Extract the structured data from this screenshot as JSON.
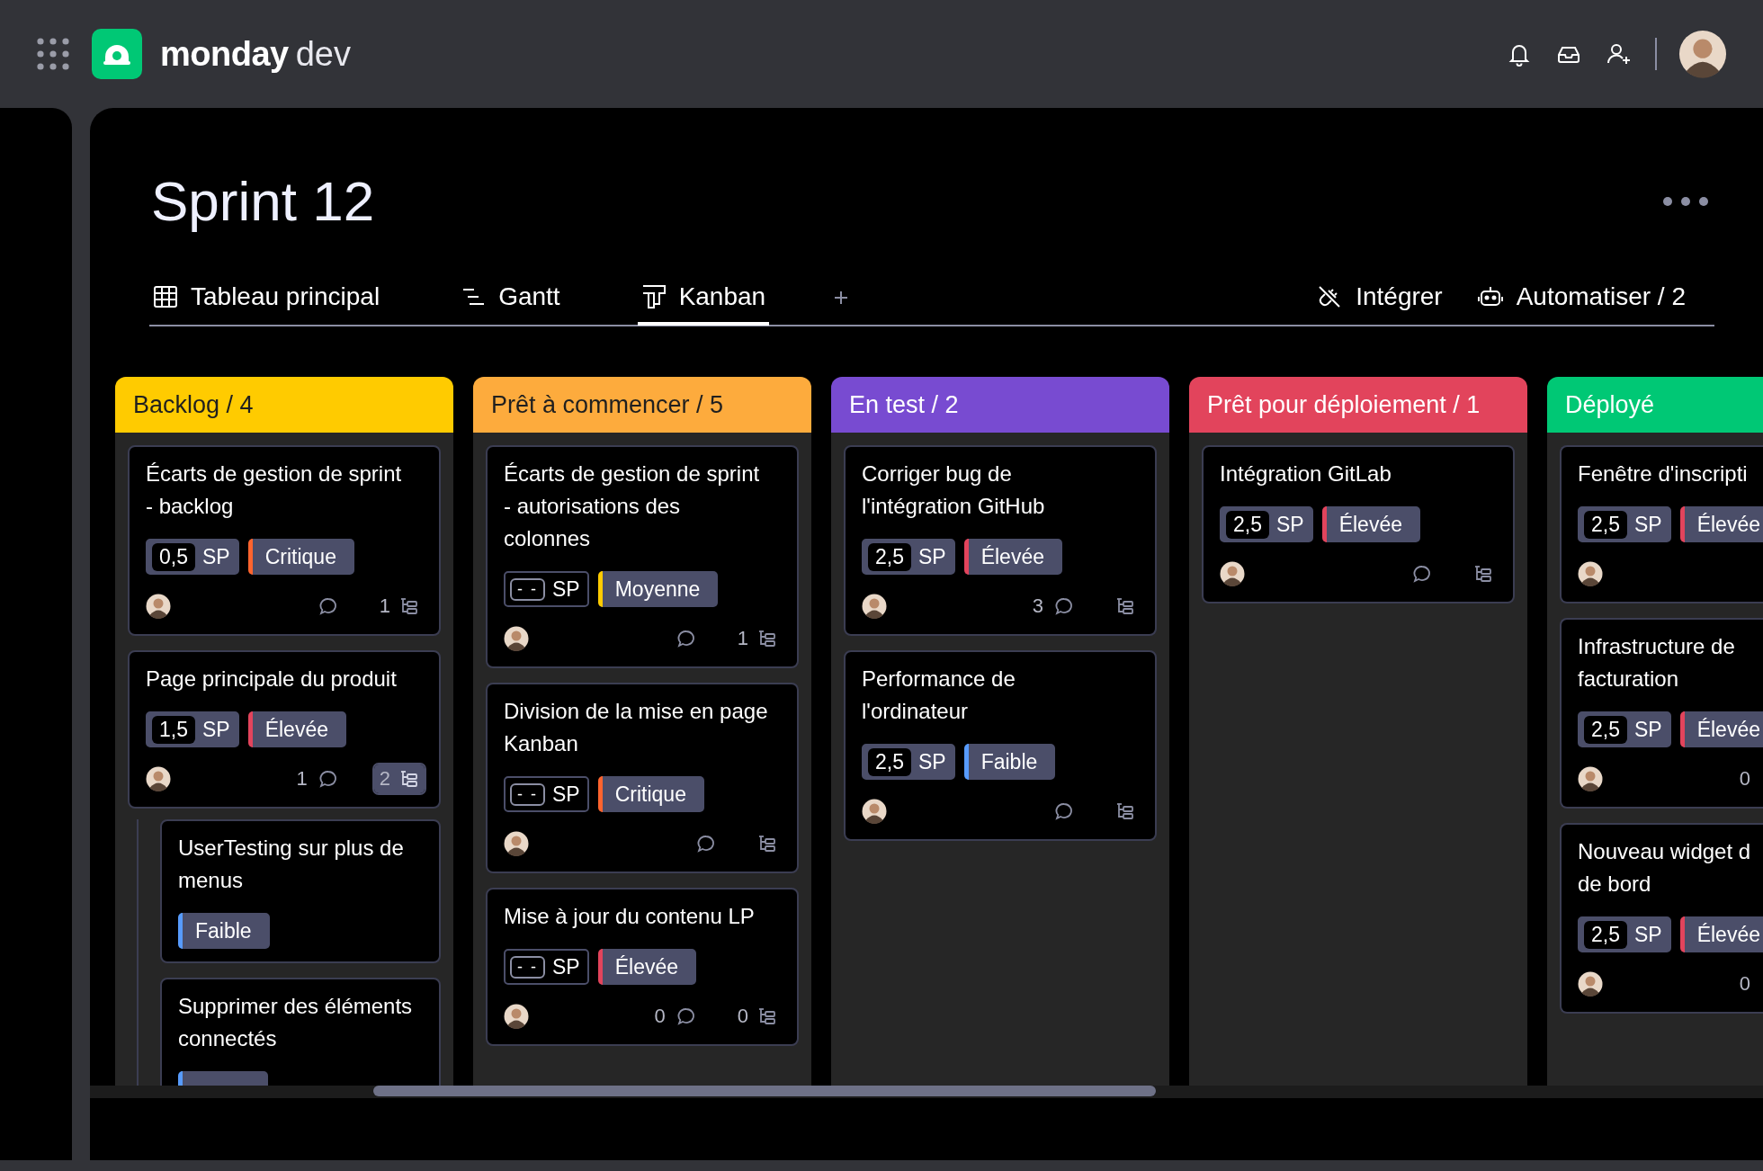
{
  "app": {
    "brand": "monday",
    "product": "dev"
  },
  "board": {
    "title": "Sprint 12"
  },
  "views": [
    {
      "label": "Tableau principal",
      "kind": "table",
      "selected": false
    },
    {
      "label": "Gantt",
      "kind": "gantt",
      "selected": false
    },
    {
      "label": "Kanban",
      "kind": "kanban",
      "selected": true
    }
  ],
  "view_actions": [
    {
      "label": "Intégrer",
      "kind": "integrate"
    },
    {
      "label": "Automatiser / 2",
      "kind": "automate"
    }
  ],
  "columns": [
    {
      "title": "Backlog / 4",
      "color": "#ffcb00",
      "cut": false,
      "cards": [
        {
          "title": "Écarts de gestion de sprint\n- backlog",
          "points": {
            "value": "0,5",
            "unit": "SP",
            "set": true
          },
          "priority": {
            "label": "Critique",
            "color": "#ff642e"
          },
          "has_assignee": true,
          "subitem_count": "1",
          "subitems_open": false
        },
        {
          "title": "Page principale du produit",
          "points": {
            "value": "1,5",
            "unit": "SP",
            "set": true
          },
          "priority": {
            "label": "Élevée",
            "color": "#e2445c"
          },
          "has_assignee": true,
          "comment_count": "1",
          "subitem_count": "2",
          "subitems_open": true,
          "children": [
            {
              "title": "UserTesting sur plus de\nmenus",
              "priority": {
                "label": "Faible",
                "color": "#579bfc"
              },
              "has_assignee": false
            },
            {
              "title": "Supprimer des éléments\nconnectés",
              "priority": {
                "color": "#579bfc"
              },
              "has_assignee": false
            }
          ]
        }
      ]
    },
    {
      "title": "Prêt à commencer / 5",
      "color": "#fdab3d",
      "cut": false,
      "cards": [
        {
          "title": "Écarts de gestion de sprint\n- autorisations des\ncolonnes",
          "points": {
            "value": "- -",
            "unit": "SP",
            "set": false
          },
          "priority": {
            "label": "Moyenne",
            "color": "#ffcb00"
          },
          "has_assignee": true,
          "subitem_count": "1",
          "subitems_open": false
        },
        {
          "title": "Division de la mise en page\nKanban",
          "points": {
            "value": "- -",
            "unit": "SP",
            "set": false
          },
          "priority": {
            "label": "Critique",
            "color": "#ff642e"
          },
          "has_assignee": true,
          "subitems_open": false
        },
        {
          "title": "Mise à jour du contenu LP",
          "points": {
            "value": "- -",
            "unit": "SP",
            "set": false
          },
          "priority": {
            "label": "Élevée",
            "color": "#e2445c"
          },
          "has_assignee": true,
          "comment_count": "0",
          "subitem_count": "0",
          "subitems_open": false
        }
      ]
    },
    {
      "title": "En test / 2",
      "color": "#784bd1",
      "cut": false,
      "cards": [
        {
          "title": "Corriger bug de\nl'intégration GitHub",
          "points": {
            "value": "2,5",
            "unit": "SP",
            "set": true
          },
          "priority": {
            "label": "Élevée",
            "color": "#e2445c"
          },
          "has_assignee": true,
          "comment_count": "3",
          "subitems_open": false
        },
        {
          "title": "Performance de\nl'ordinateur",
          "points": {
            "value": "2,5",
            "unit": "SP",
            "set": true
          },
          "priority": {
            "label": "Faible",
            "color": "#579bfc"
          },
          "has_assignee": true,
          "subitems_open": false
        }
      ]
    },
    {
      "title": "Prêt pour déploiement / 1",
      "color": "#e2445c",
      "cut": false,
      "cards": [
        {
          "title": "Intégration GitLab",
          "points": {
            "value": "2,5",
            "unit": "SP",
            "set": true
          },
          "priority": {
            "label": "Élevée",
            "color": "#e2445c"
          },
          "has_assignee": true,
          "subitems_open": false
        }
      ]
    },
    {
      "title": "Déployé",
      "color": "#00c875",
      "cut": true,
      "cards": [
        {
          "title": "Fenêtre d'inscripti",
          "points": {
            "value": "2,5",
            "unit": "SP",
            "set": true
          },
          "priority": {
            "label": "Élevée",
            "color": "#e2445c"
          },
          "has_assignee": true
        },
        {
          "title": "Infrastructure de\nfacturation",
          "points": {
            "value": "2,5",
            "unit": "SP",
            "set": true
          },
          "priority": {
            "label": "Élevée",
            "color": "#e2445c"
          },
          "has_assignee": true,
          "comment_count": "0"
        },
        {
          "title": "Nouveau widget d\nde bord",
          "points": {
            "value": "2,5",
            "unit": "SP",
            "set": true
          },
          "priority": {
            "label": "Élevée",
            "color": "#e2445c"
          },
          "has_assignee": true,
          "comment_count": "0"
        }
      ]
    }
  ]
}
